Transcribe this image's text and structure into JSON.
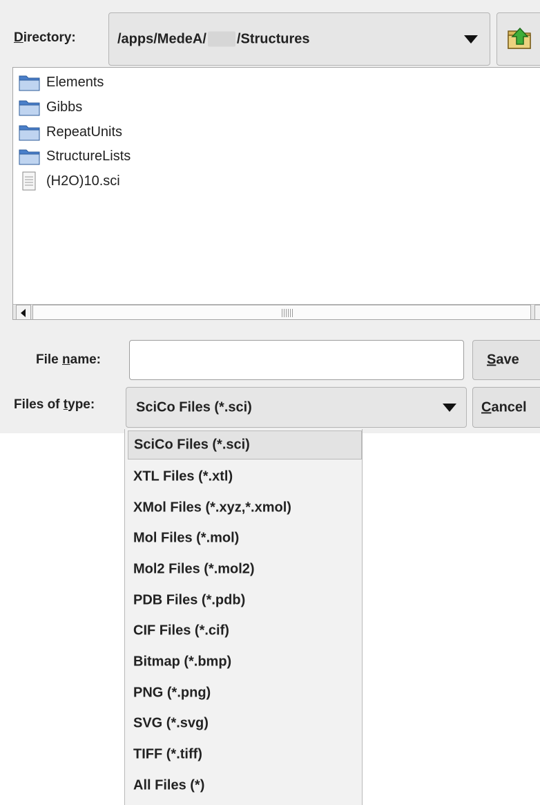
{
  "directory": {
    "label_prefix": "D",
    "label_rest": "irectory:",
    "path_start": "/apps/MedeA/",
    "path_end": "/Structures"
  },
  "files": [
    {
      "name": "Elements",
      "icon": "folder-icon"
    },
    {
      "name": "Gibbs",
      "icon": "folder-icon"
    },
    {
      "name": "RepeatUnits",
      "icon": "folder-icon"
    },
    {
      "name": "StructureLists",
      "icon": "folder-icon"
    },
    {
      "name": "(H2O)10.sci",
      "icon": "file-icon"
    }
  ],
  "filename": {
    "label_a": "File ",
    "label_u": "n",
    "label_b": "ame:",
    "value": ""
  },
  "filetype": {
    "label_a": "Files of ",
    "label_u": "t",
    "label_b": "ype:",
    "value": "SciCo Files (*.sci)"
  },
  "buttons": {
    "save_u": "S",
    "save_rest": "ave",
    "cancel_u": "C",
    "cancel_rest": "ancel",
    "up_icon": "up-folder-icon"
  },
  "options": [
    "SciCo Files (*.sci)",
    "XTL Files (*.xtl)",
    "XMol Files (*.xyz,*.xmol)",
    "Mol Files (*.mol)",
    "Mol2 Files (*.mol2)",
    "PDB Files (*.pdb)",
    "CIF Files (*.cif)",
    "Bitmap (*.bmp)",
    "PNG (*.png)",
    "SVG (*.svg)",
    "TIFF (*.tiff)",
    "All Files (*)"
  ],
  "colors": {
    "dialog_bg": "#efefef",
    "folder_blue": "#4a7fc9",
    "folder_light": "#bfd4f0",
    "up_arrow_green": "#3fae3a"
  }
}
